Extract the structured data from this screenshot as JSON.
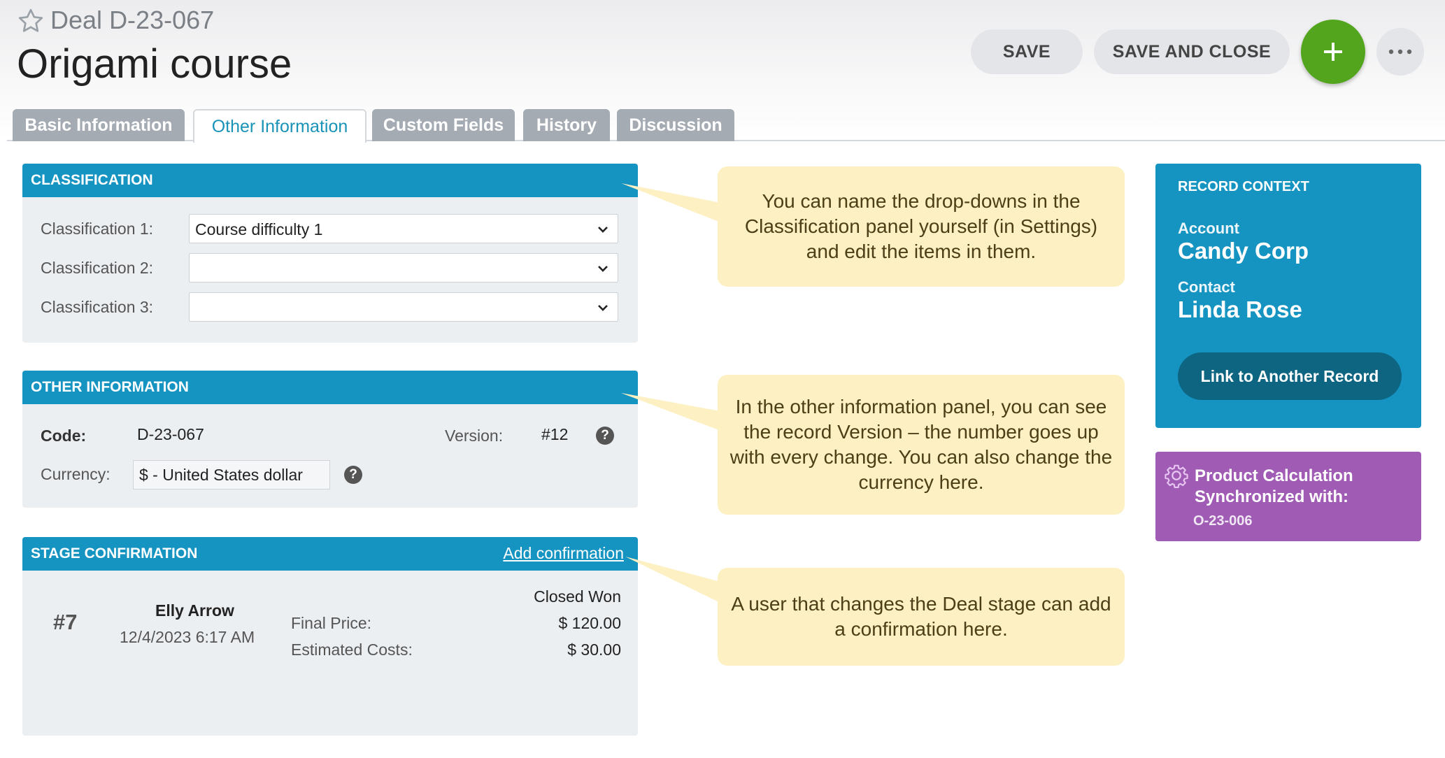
{
  "header": {
    "deal_label": "Deal",
    "deal_code": "D-23-067",
    "title": "Origami course",
    "save_label": "SAVE",
    "save_close_label": "SAVE AND CLOSE",
    "add_label": "+",
    "more_label": "..."
  },
  "tabs": [
    {
      "label": "Basic Information",
      "active": false
    },
    {
      "label": "Other Information",
      "active": true
    },
    {
      "label": "Custom Fields",
      "active": false
    },
    {
      "label": "History",
      "active": false
    },
    {
      "label": "Discussion",
      "active": false
    }
  ],
  "classification": {
    "heading": "CLASSIFICATION",
    "rows": [
      {
        "label": "Classification 1:",
        "value": "Course difficulty 1"
      },
      {
        "label": "Classification 2:",
        "value": ""
      },
      {
        "label": "Classification 3:",
        "value": ""
      }
    ]
  },
  "other_info": {
    "heading": "OTHER INFORMATION",
    "code_label": "Code:",
    "code_value": "D-23-067",
    "version_label": "Version:",
    "version_value": "#12",
    "currency_label": "Currency:",
    "currency_value": "$ - United States dollar",
    "help_glyph": "?"
  },
  "stage": {
    "heading": "STAGE CONFIRMATION",
    "add_link": "Add confirmation",
    "number": "#7",
    "user": "Elly Arrow",
    "datetime": "12/4/2023 6:17 AM",
    "stage_name": "Closed Won",
    "final_price_label": "Final Price:",
    "final_price_value": "$ 120.00",
    "est_costs_label": "Estimated Costs:",
    "est_costs_value": "$ 30.00"
  },
  "callouts": [
    "You can name the drop-downs in the Classification panel yourself (in Settings) and edit the items in them.",
    "In the other information panel, you can see the record Version – the number goes up with every change. You can also change the currency here.",
    "A user that changes the Deal stage can add a confirmation here."
  ],
  "record_context": {
    "heading": "RECORD CONTEXT",
    "account_label": "Account",
    "account_value": "Candy Corp",
    "contact_label": "Contact",
    "contact_value": "Linda Rose",
    "link_button": "Link to Another Record"
  },
  "sync_box": {
    "title": "Product Calculation Synchronized with:",
    "code": "O-23-006"
  },
  "colors": {
    "panel_header": "#1594c2",
    "add_button": "#52a51d",
    "sync_box": "#a05bb5",
    "callout": "#fdf0c3",
    "active_tab_text": "#1a93b8"
  }
}
